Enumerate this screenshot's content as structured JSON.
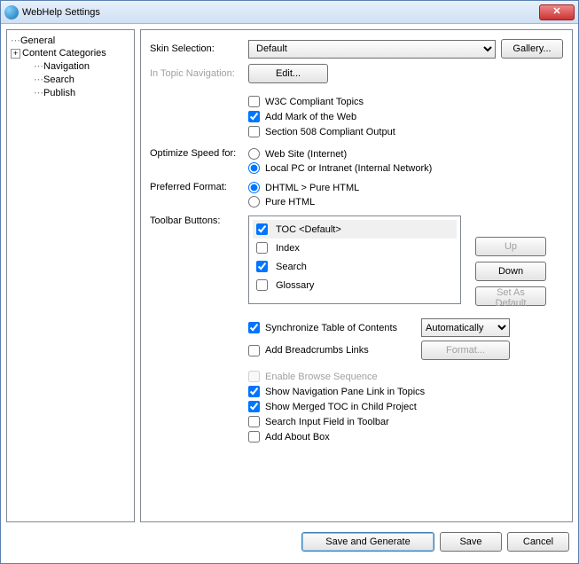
{
  "window": {
    "title": "WebHelp Settings"
  },
  "tree": {
    "items": [
      {
        "label": "General",
        "expandable": false
      },
      {
        "label": "Content Categories",
        "expandable": true
      },
      {
        "label": "Navigation",
        "child": true
      },
      {
        "label": "Search",
        "child": true
      },
      {
        "label": "Publish",
        "child": true
      }
    ]
  },
  "labels": {
    "skin": "Skin Selection:",
    "intopic": "In Topic Navigation:",
    "optimize": "Optimize Speed for:",
    "preferred": "Preferred Format:",
    "toolbar": "Toolbar Buttons:"
  },
  "skin": {
    "value": "Default",
    "gallery": "Gallery..."
  },
  "intopic": {
    "edit": "Edit..."
  },
  "checks1": {
    "w3c": "W3C Compliant Topics",
    "motw": "Add Mark of the Web",
    "s508": "Section 508 Compliant Output"
  },
  "optimize": {
    "web": "Web Site (Internet)",
    "local": "Local PC or Intranet (Internal Network)"
  },
  "preferred": {
    "dhtml": "DHTML > Pure HTML",
    "pure": "Pure HTML"
  },
  "toolbarList": {
    "toc": "TOC <Default>",
    "index": "Index",
    "search": "Search",
    "glossary": "Glossary"
  },
  "sidebtn": {
    "up": "Up",
    "down": "Down",
    "setdef": "Set As Default"
  },
  "sync": {
    "label": "Synchronize Table of Contents",
    "mode": "Automatically"
  },
  "bread": {
    "label": "Add Breadcrumbs Links",
    "format": "Format..."
  },
  "checks2": {
    "browse": "Enable Browse Sequence",
    "navpane": "Show Navigation Pane Link in Topics",
    "merged": "Show Merged TOC in Child Project",
    "searchinput": "Search Input Field in Toolbar",
    "about": "Add About Box"
  },
  "footer": {
    "savegen": "Save and Generate",
    "save": "Save",
    "cancel": "Cancel"
  }
}
